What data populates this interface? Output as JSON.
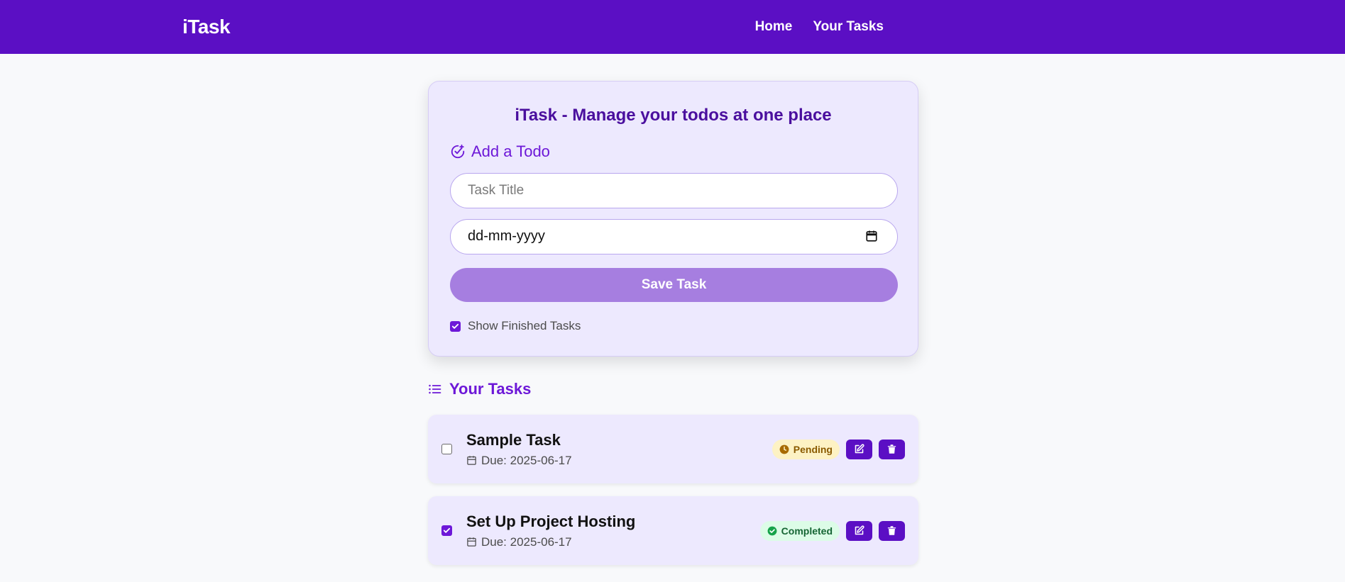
{
  "navbar": {
    "brand": "iTask",
    "links": [
      {
        "label": "Home"
      },
      {
        "label": "Your Tasks"
      }
    ]
  },
  "form": {
    "title": "iTask - Manage your todos at one place",
    "add_heading": "Add a Todo",
    "title_input": {
      "value": "",
      "placeholder": "Task Title"
    },
    "date_input": {
      "display": "dd-mm-yyyy"
    },
    "save_label": "Save Task",
    "show_finished": {
      "label": "Show Finished Tasks",
      "checked": true
    }
  },
  "tasks_heading": "Your Tasks",
  "tasks": [
    {
      "title": "Sample Task",
      "due": "Due: 2025-06-17",
      "status": "Pending",
      "checked": false
    },
    {
      "title": "Set Up Project Hosting",
      "due": "Due: 2025-06-17",
      "status": "Completed",
      "checked": true
    }
  ],
  "colors": {
    "brand_purple": "#5b0fc4",
    "accent_purple": "#6d18d8",
    "save_button": "#a67ee0",
    "card_bg": "#ede9fe",
    "pending_bg": "#fdf2c4",
    "completed_bg": "#dcfce7"
  },
  "icons": {
    "add_heading": "circle-check-plus-icon",
    "tasks_heading": "list-icon",
    "due": "calendar-icon",
    "pending": "clock-icon",
    "completed": "check-circle-icon",
    "edit": "edit-icon",
    "delete": "trash-icon",
    "date_picker": "calendar-icon"
  }
}
